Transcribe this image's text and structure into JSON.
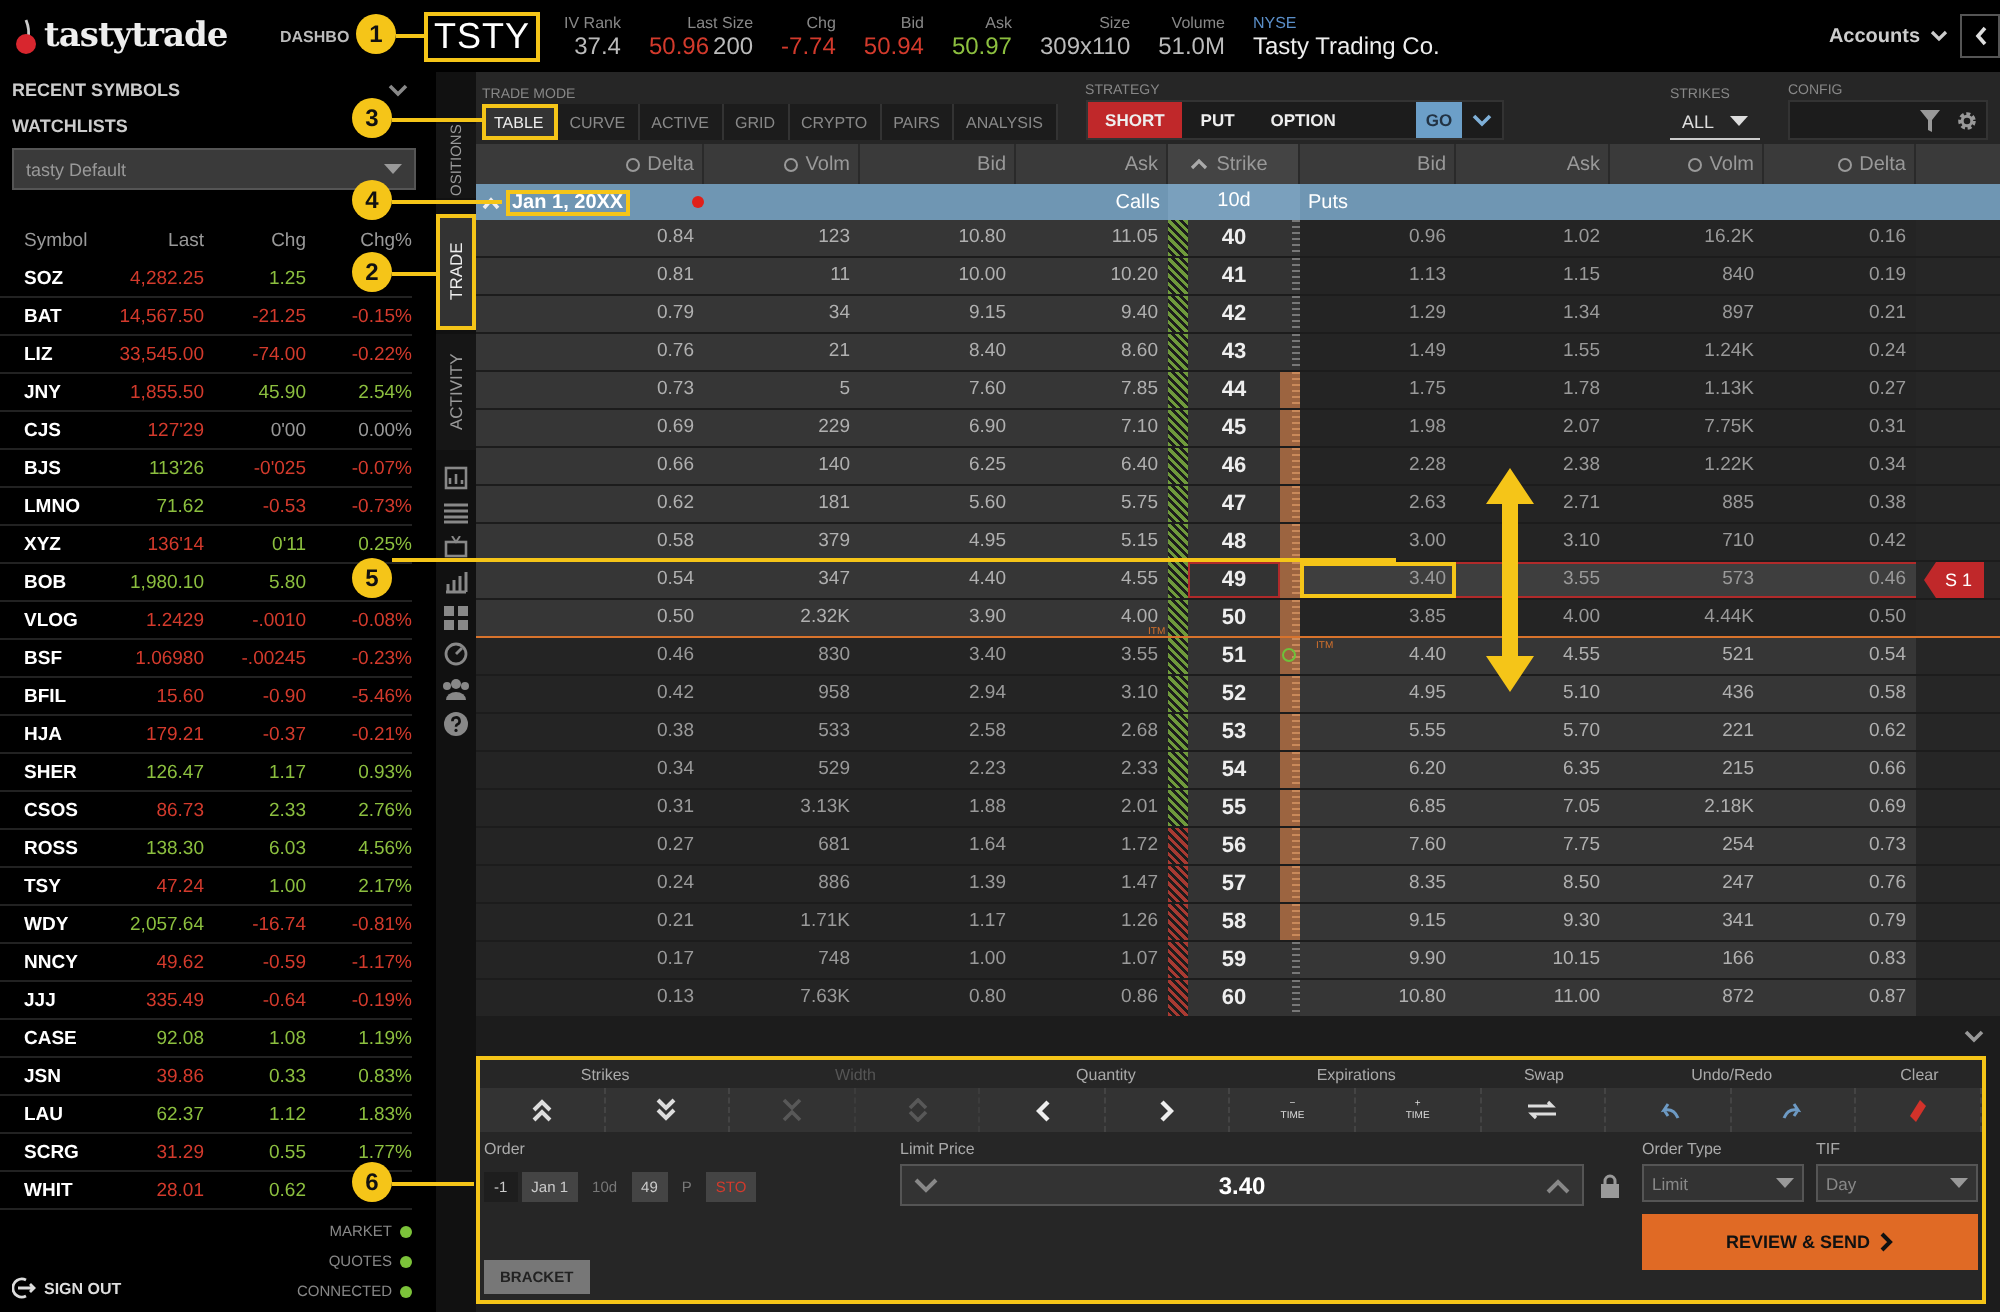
{
  "header": {
    "logo": "tastytrade",
    "nav": "DASHBO",
    "symbol": {
      "text": "TSTY",
      "highlighted": true
    },
    "stats": [
      {
        "label": "IV Rank",
        "parts": [
          {
            "text": "37.4",
            "color": "#bbbbbb"
          }
        ]
      },
      {
        "label": "Last Size",
        "parts": [
          {
            "text": "50.96",
            "color": "#d33a2c"
          },
          {
            "text": "200",
            "color": "#bbbbbb"
          }
        ]
      },
      {
        "label": "Chg",
        "parts": [
          {
            "text": "-7.74",
            "color": "#d33a2c"
          }
        ]
      },
      {
        "label": "Bid",
        "parts": [
          {
            "text": "50.94",
            "color": "#d33a2c"
          }
        ]
      },
      {
        "label": "Ask",
        "parts": [
          {
            "text": "50.97",
            "color": "#8cbf3f"
          }
        ]
      },
      {
        "label": "Size",
        "parts": [
          {
            "text": "309x110",
            "color": "#bbbbbb"
          }
        ]
      },
      {
        "label": "Volume",
        "parts": [
          {
            "text": "51.0M",
            "color": "#bbbbbb"
          }
        ]
      }
    ],
    "exchange": "NYSE",
    "company": "Tasty Trading Co.",
    "accounts": "Accounts"
  },
  "sidebar": {
    "recent": "RECENT SYMBOLS",
    "watchlists": "WATCHLISTS",
    "watchlist_select": "tasty Default",
    "columns": [
      "Symbol",
      "Last",
      "Chg",
      "Chg%"
    ],
    "rows": [
      {
        "symbol": "SOZ",
        "last": {
          "text": "4,282.25",
          "color": "#d33a2c"
        },
        "chg": {
          "text": "1.25",
          "color": "#8cbf3f"
        }
      },
      {
        "symbol": "BAT",
        "last": {
          "text": "14,567.50",
          "color": "#d33a2c"
        },
        "chg": {
          "text": "-21.25",
          "color": "#d33a2c"
        },
        "pct": {
          "text": "-0.15%",
          "color": "#d33a2c"
        }
      },
      {
        "symbol": "LIZ",
        "last": {
          "text": "33,545.00",
          "color": "#d33a2c"
        },
        "chg": {
          "text": "-74.00",
          "color": "#d33a2c"
        },
        "pct": {
          "text": "-0.22%",
          "color": "#d33a2c"
        }
      },
      {
        "symbol": "JNY",
        "last": {
          "text": "1,855.50",
          "color": "#d33a2c"
        },
        "chg": {
          "text": "45.90",
          "color": "#8cbf3f"
        },
        "pct": {
          "text": "2.54%",
          "color": "#8cbf3f"
        }
      },
      {
        "symbol": "CJS",
        "last": {
          "text": "127'29",
          "color": "#d33a2c"
        },
        "chg": {
          "text": "0'00",
          "color": "#999999"
        },
        "pct": {
          "text": "0.00%",
          "color": "#999999"
        }
      },
      {
        "symbol": "BJS",
        "last": {
          "text": "113'26",
          "color": "#8cbf3f"
        },
        "chg": {
          "text": "-0'025",
          "color": "#d33a2c"
        },
        "pct": {
          "text": "-0.07%",
          "color": "#d33a2c"
        }
      },
      {
        "symbol": "LMNO",
        "last": {
          "text": "71.62",
          "color": "#8cbf3f"
        },
        "chg": {
          "text": "-0.53",
          "color": "#d33a2c"
        },
        "pct": {
          "text": "-0.73%",
          "color": "#d33a2c"
        }
      },
      {
        "symbol": "XYZ",
        "last": {
          "text": "136'14",
          "color": "#d33a2c"
        },
        "chg": {
          "text": "0'11",
          "color": "#8cbf3f"
        },
        "pct": {
          "text": "0.25%",
          "color": "#8cbf3f"
        }
      },
      {
        "symbol": "BOB",
        "last": {
          "text": "1,980.10",
          "color": "#8cbf3f"
        },
        "chg": {
          "text": "5.80",
          "color": "#8cbf3f"
        }
      },
      {
        "symbol": "VLOG",
        "last": {
          "text": "1.2429",
          "color": "#d33a2c"
        },
        "chg": {
          "text": "-.0010",
          "color": "#d33a2c"
        },
        "pct": {
          "text": "-0.08%",
          "color": "#d33a2c"
        }
      },
      {
        "symbol": "BSF",
        "last": {
          "text": "1.06980",
          "color": "#d33a2c"
        },
        "chg": {
          "text": "-.00245",
          "color": "#d33a2c"
        },
        "pct": {
          "text": "-0.23%",
          "color": "#d33a2c"
        }
      },
      {
        "symbol": "BFIL",
        "last": {
          "text": "15.60",
          "color": "#d33a2c"
        },
        "chg": {
          "text": "-0.90",
          "color": "#d33a2c"
        },
        "pct": {
          "text": "-5.46%",
          "color": "#d33a2c"
        }
      },
      {
        "symbol": "HJA",
        "last": {
          "text": "179.21",
          "color": "#d33a2c"
        },
        "chg": {
          "text": "-0.37",
          "color": "#d33a2c"
        },
        "pct": {
          "text": "-0.21%",
          "color": "#d33a2c"
        }
      },
      {
        "symbol": "SHER",
        "last": {
          "text": "126.47",
          "color": "#8cbf3f"
        },
        "chg": {
          "text": "1.17",
          "color": "#8cbf3f"
        },
        "pct": {
          "text": "0.93%",
          "color": "#8cbf3f"
        }
      },
      {
        "symbol": "CSOS",
        "last": {
          "text": "86.73",
          "color": "#d33a2c"
        },
        "chg": {
          "text": "2.33",
          "color": "#8cbf3f"
        },
        "pct": {
          "text": "2.76%",
          "color": "#8cbf3f"
        }
      },
      {
        "symbol": "ROSS",
        "last": {
          "text": "138.30",
          "color": "#8cbf3f"
        },
        "chg": {
          "text": "6.03",
          "color": "#8cbf3f"
        },
        "pct": {
          "text": "4.56%",
          "color": "#8cbf3f"
        }
      },
      {
        "symbol": "TSY",
        "last": {
          "text": "47.24",
          "color": "#d33a2c"
        },
        "chg": {
          "text": "1.00",
          "color": "#8cbf3f"
        },
        "pct": {
          "text": "2.17%",
          "color": "#8cbf3f"
        }
      },
      {
        "symbol": "WDY",
        "last": {
          "text": "2,057.64",
          "color": "#8cbf3f"
        },
        "chg": {
          "text": "-16.74",
          "color": "#d33a2c"
        },
        "pct": {
          "text": "-0.81%",
          "color": "#d33a2c"
        }
      },
      {
        "symbol": "NNCY",
        "last": {
          "text": "49.62",
          "color": "#d33a2c"
        },
        "chg": {
          "text": "-0.59",
          "color": "#d33a2c"
        },
        "pct": {
          "text": "-1.17%",
          "color": "#d33a2c"
        }
      },
      {
        "symbol": "JJJ",
        "last": {
          "text": "335.49",
          "color": "#d33a2c"
        },
        "chg": {
          "text": "-0.64",
          "color": "#d33a2c"
        },
        "pct": {
          "text": "-0.19%",
          "color": "#d33a2c"
        }
      },
      {
        "symbol": "CASE",
        "last": {
          "text": "92.08",
          "color": "#8cbf3f"
        },
        "chg": {
          "text": "1.08",
          "color": "#8cbf3f"
        },
        "pct": {
          "text": "1.19%",
          "color": "#8cbf3f"
        }
      },
      {
        "symbol": "JSN",
        "last": {
          "text": "39.86",
          "color": "#d33a2c"
        },
        "chg": {
          "text": "0.33",
          "color": "#8cbf3f"
        },
        "pct": {
          "text": "0.83%",
          "color": "#8cbf3f"
        }
      },
      {
        "symbol": "LAU",
        "last": {
          "text": "62.37",
          "color": "#8cbf3f"
        },
        "chg": {
          "text": "1.12",
          "color": "#8cbf3f"
        },
        "pct": {
          "text": "1.83%",
          "color": "#8cbf3f"
        }
      },
      {
        "symbol": "SCRG",
        "last": {
          "text": "31.29",
          "color": "#d33a2c"
        },
        "chg": {
          "text": "0.55",
          "color": "#8cbf3f"
        },
        "pct": {
          "text": "1.77%",
          "color": "#8cbf3f"
        }
      },
      {
        "symbol": "WHIT",
        "last": {
          "text": "28.01",
          "color": "#d33a2c"
        },
        "chg": {
          "text": "0.62",
          "color": "#8cbf3f"
        }
      }
    ],
    "status": [
      {
        "label": "MARKET",
        "color": "#7cc23a"
      },
      {
        "label": "QUOTES",
        "color": "#7cc23a"
      },
      {
        "label": "CONNECTED",
        "color": "#7cc23a"
      }
    ],
    "sign_out": "SIGN OUT"
  },
  "side_tabs": [
    {
      "label": "OSITIONS",
      "selected": false,
      "highlighted": false
    },
    {
      "label": "TRADE",
      "selected": true,
      "highlighted": true
    },
    {
      "label": "ACTIVITY",
      "selected": false,
      "highlighted": false
    }
  ],
  "toolbar": {
    "mode_label": "TRADE MODE",
    "modes": [
      {
        "label": "TABLE",
        "selected": true,
        "highlighted": true
      },
      {
        "label": "CURVE",
        "selected": false,
        "highlighted": false
      },
      {
        "label": "ACTIVE",
        "selected": false,
        "highlighted": false
      },
      {
        "label": "GRID",
        "selected": false,
        "highlighted": false
      },
      {
        "label": "CRYPTO",
        "selected": false,
        "highlighted": false
      },
      {
        "label": "PAIRS",
        "selected": false,
        "highlighted": false
      },
      {
        "label": "ANALYSIS",
        "selected": false,
        "highlighted": false
      }
    ],
    "strategy_label": "STRATEGY",
    "strategy": [
      {
        "label": "SHORT",
        "kind": "side"
      },
      {
        "label": "PUT",
        "kind": "plain"
      },
      {
        "label": "OPTION",
        "kind": "wide"
      }
    ],
    "go": "GO",
    "strikes_label": "STRIKES",
    "strikes_value": "ALL",
    "config_label": "CONFIG"
  },
  "chain": {
    "columns": [
      {
        "label": "Delta",
        "kind": "toggle"
      },
      {
        "label": "Volm",
        "kind": "toggle"
      },
      {
        "label": "Bid",
        "kind": "plain"
      },
      {
        "label": "Ask",
        "kind": "plain"
      },
      {
        "label": "Strike",
        "kind": "sorted"
      },
      {
        "label": "Bid",
        "kind": "plain"
      },
      {
        "label": "Ask",
        "kind": "plain"
      },
      {
        "label": "Volm",
        "kind": "toggle"
      },
      {
        "label": "Delta",
        "kind": "toggle"
      }
    ],
    "expiration": {
      "date": "Jan 1, 20XX",
      "highlighted": true,
      "calls": "Calls",
      "days": "10d",
      "puts": "Puts"
    },
    "itm_labels": [
      "ITM",
      "ITM"
    ],
    "rows": [
      {
        "strike": "40",
        "call": [
          "0.84",
          "123",
          "10.80",
          "11.05"
        ],
        "put": [
          "0.96",
          "1.02",
          "16.2K",
          "0.16"
        ],
        "call_itm": true,
        "in_range": false,
        "price_marker": false,
        "color": "#6f9a3c",
        "selected": false
      },
      {
        "strike": "41",
        "call": [
          "0.81",
          "11",
          "10.00",
          "10.20"
        ],
        "put": [
          "1.13",
          "1.15",
          "840",
          "0.19"
        ],
        "call_itm": true,
        "in_range": false,
        "price_marker": false,
        "color": "#6f9a3c",
        "selected": false
      },
      {
        "strike": "42",
        "call": [
          "0.79",
          "34",
          "9.15",
          "9.40"
        ],
        "put": [
          "1.29",
          "1.34",
          "897",
          "0.21"
        ],
        "call_itm": true,
        "in_range": false,
        "price_marker": false,
        "color": "#6f9a3c",
        "selected": false
      },
      {
        "strike": "43",
        "call": [
          "0.76",
          "21",
          "8.40",
          "8.60"
        ],
        "put": [
          "1.49",
          "1.55",
          "1.24K",
          "0.24"
        ],
        "call_itm": true,
        "in_range": false,
        "price_marker": false,
        "color": "#6f9a3c",
        "selected": false
      },
      {
        "strike": "44",
        "call": [
          "0.73",
          "5",
          "7.60",
          "7.85"
        ],
        "put": [
          "1.75",
          "1.78",
          "1.13K",
          "0.27"
        ],
        "call_itm": true,
        "in_range": true,
        "price_marker": false,
        "color": "#6f9a3c",
        "selected": false
      },
      {
        "strike": "45",
        "call": [
          "0.69",
          "229",
          "6.90",
          "7.10"
        ],
        "put": [
          "1.98",
          "2.07",
          "7.75K",
          "0.31"
        ],
        "call_itm": true,
        "in_range": true,
        "price_marker": false,
        "color": "#6f9a3c",
        "selected": false
      },
      {
        "strike": "46",
        "call": [
          "0.66",
          "140",
          "6.25",
          "6.40"
        ],
        "put": [
          "2.28",
          "2.38",
          "1.22K",
          "0.34"
        ],
        "call_itm": true,
        "in_range": true,
        "price_marker": false,
        "color": "#6f9a3c",
        "selected": false
      },
      {
        "strike": "47",
        "call": [
          "0.62",
          "181",
          "5.60",
          "5.75"
        ],
        "put": [
          "2.63",
          "2.71",
          "885",
          "0.38"
        ],
        "call_itm": true,
        "in_range": true,
        "price_marker": false,
        "color": "#6f9a3c",
        "selected": false
      },
      {
        "strike": "48",
        "call": [
          "0.58",
          "379",
          "4.95",
          "5.15"
        ],
        "put": [
          "3.00",
          "3.10",
          "710",
          "0.42"
        ],
        "call_itm": true,
        "in_range": true,
        "price_marker": false,
        "color": "#6f9a3c",
        "selected": false
      },
      {
        "strike": "49",
        "call": [
          "0.54",
          "347",
          "4.40",
          "4.55"
        ],
        "put": [
          "3.40",
          "3.55",
          "573",
          "0.46"
        ],
        "call_itm": true,
        "in_range": true,
        "price_marker": false,
        "color": "#6f9a3c",
        "selected": true,
        "tag": "S 1"
      },
      {
        "strike": "50",
        "call": [
          "0.50",
          "2.32K",
          "3.90",
          "4.00"
        ],
        "put": [
          "3.85",
          "4.00",
          "4.44K",
          "0.50"
        ],
        "call_itm": true,
        "in_range": true,
        "price_marker": false,
        "color": "#6f9a3c",
        "selected": false
      },
      {
        "strike": "51",
        "call": [
          "0.46",
          "830",
          "3.40",
          "3.55"
        ],
        "put": [
          "4.40",
          "4.55",
          "521",
          "0.54"
        ],
        "call_itm": false,
        "in_range": true,
        "price_marker": true,
        "color": "#6f9a3c",
        "selected": false
      },
      {
        "strike": "52",
        "call": [
          "0.42",
          "958",
          "2.94",
          "3.10"
        ],
        "put": [
          "4.95",
          "5.10",
          "436",
          "0.58"
        ],
        "call_itm": false,
        "in_range": true,
        "price_marker": false,
        "color": "#6f9a3c",
        "selected": false
      },
      {
        "strike": "53",
        "call": [
          "0.38",
          "533",
          "2.58",
          "2.68"
        ],
        "put": [
          "5.55",
          "5.70",
          "221",
          "0.62"
        ],
        "call_itm": false,
        "in_range": true,
        "price_marker": false,
        "color": "#6f9a3c",
        "selected": false
      },
      {
        "strike": "54",
        "call": [
          "0.34",
          "529",
          "2.23",
          "2.33"
        ],
        "put": [
          "6.20",
          "6.35",
          "215",
          "0.66"
        ],
        "call_itm": false,
        "in_range": true,
        "price_marker": false,
        "color": "#6f9a3c",
        "selected": false
      },
      {
        "strike": "55",
        "call": [
          "0.31",
          "3.13K",
          "1.88",
          "2.01"
        ],
        "put": [
          "6.85",
          "7.05",
          "2.18K",
          "0.69"
        ],
        "call_itm": false,
        "in_range": true,
        "price_marker": false,
        "color": "#6f9a3c",
        "selected": false
      },
      {
        "strike": "56",
        "call": [
          "0.27",
          "681",
          "1.64",
          "1.72"
        ],
        "put": [
          "7.60",
          "7.75",
          "254",
          "0.73"
        ],
        "call_itm": false,
        "in_range": true,
        "price_marker": false,
        "color": "#a83a32",
        "selected": false
      },
      {
        "strike": "57",
        "call": [
          "0.24",
          "886",
          "1.39",
          "1.47"
        ],
        "put": [
          "8.35",
          "8.50",
          "247",
          "0.76"
        ],
        "call_itm": false,
        "in_range": true,
        "price_marker": false,
        "color": "#a83a32",
        "selected": false
      },
      {
        "strike": "58",
        "call": [
          "0.21",
          "1.71K",
          "1.17",
          "1.26"
        ],
        "put": [
          "9.15",
          "9.30",
          "341",
          "0.79"
        ],
        "call_itm": false,
        "in_range": true,
        "price_marker": false,
        "color": "#a83a32",
        "selected": false
      },
      {
        "strike": "59",
        "call": [
          "0.17",
          "748",
          "1.00",
          "1.07"
        ],
        "put": [
          "9.90",
          "10.15",
          "166",
          "0.83"
        ],
        "call_itm": false,
        "in_range": false,
        "price_marker": false,
        "color": "#a83a32",
        "selected": false
      },
      {
        "strike": "60",
        "call": [
          "0.13",
          "7.63K",
          "0.80",
          "0.86"
        ],
        "put": [
          "10.80",
          "11.00",
          "872",
          "0.87"
        ],
        "call_itm": false,
        "in_range": false,
        "price_marker": false,
        "color": "#a83a32",
        "selected": false
      }
    ]
  },
  "order": {
    "highlighted": true,
    "groups": [
      {
        "label": "Strikes",
        "disabled": false,
        "buttons": [
          {
            "kind": "double-up"
          },
          {
            "kind": "double-down"
          }
        ]
      },
      {
        "label": "Width",
        "disabled": true,
        "buttons": [
          {
            "kind": "collapse"
          },
          {
            "kind": "expand"
          }
        ]
      },
      {
        "label": "Quantity",
        "disabled": false,
        "buttons": [
          {
            "kind": "left"
          },
          {
            "kind": "right"
          }
        ]
      },
      {
        "label": "Expirations",
        "disabled": false,
        "buttons": [
          {
            "kind": "time",
            "sign": "−",
            "text": "TIME"
          },
          {
            "kind": "time",
            "sign": "+",
            "text": "TIME"
          }
        ]
      },
      {
        "label": "Swap",
        "disabled": false,
        "buttons": [
          {
            "kind": "swap"
          }
        ]
      },
      {
        "label": "Undo/Redo",
        "disabled": false,
        "buttons": [
          {
            "kind": "undo"
          },
          {
            "kind": "redo"
          }
        ]
      },
      {
        "label": "Clear",
        "disabled": false,
        "buttons": [
          {
            "kind": "clear"
          }
        ]
      }
    ],
    "order_label": "Order",
    "legs": [
      {
        "text": "-1",
        "kind": "plain"
      },
      {
        "text": "Jan 1",
        "kind": "chip"
      },
      {
        "text": "10d",
        "kind": "dim"
      },
      {
        "text": "49",
        "kind": "chip"
      },
      {
        "text": "P",
        "kind": "dim"
      },
      {
        "text": "STO",
        "kind": "action"
      }
    ],
    "limit_label": "Limit Price",
    "limit_value": "3.40",
    "order_type_label": "Order Type",
    "order_type": "Limit",
    "tif_label": "TIF",
    "tif": "Day",
    "bracket": "BRACKET",
    "submit": "REVIEW & SEND"
  },
  "callouts": [
    "1",
    "3",
    "4",
    "2",
    "5",
    "6"
  ]
}
